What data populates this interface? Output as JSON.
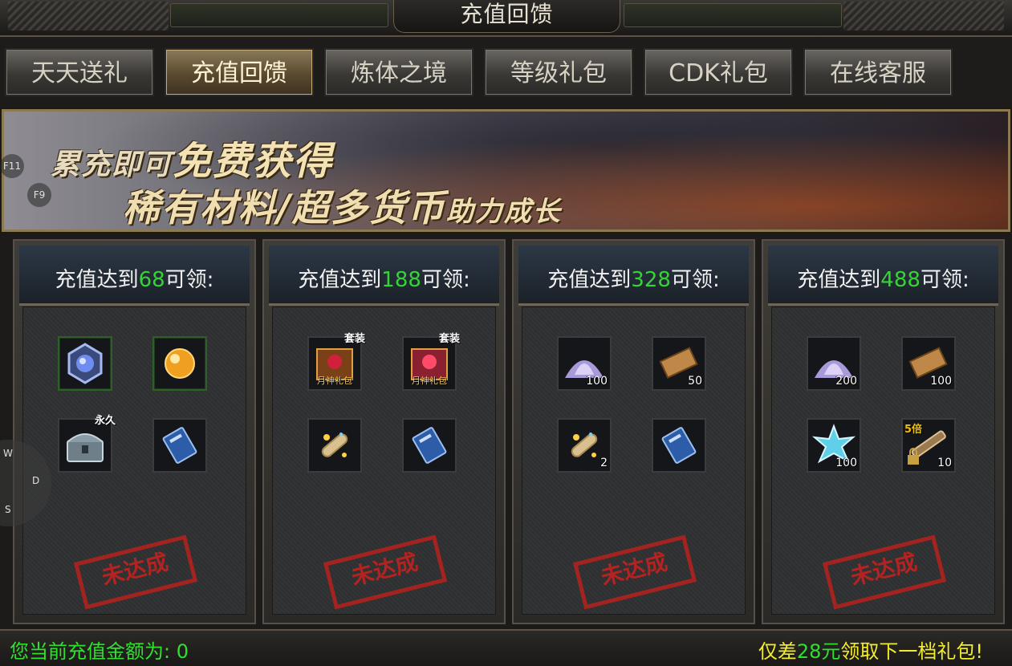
{
  "title": "充值回馈",
  "tabs": [
    {
      "label": "天天送礼",
      "active": false
    },
    {
      "label": "充值回馈",
      "active": true
    },
    {
      "label": "炼体之境",
      "active": false
    },
    {
      "label": "等级礼包",
      "active": false
    },
    {
      "label": "CDK礼包",
      "active": false
    },
    {
      "label": "在线客服",
      "active": false
    }
  ],
  "banner": {
    "line1_prefix": "累充即可",
    "line1_emph": "免费获得",
    "line2_main": "稀有材料/超多货币",
    "line2_suffix": "助力成长"
  },
  "hotkeys": {
    "f11": "F11",
    "f9": "F9"
  },
  "joystick": {
    "w": "W",
    "d": "D",
    "s": "S"
  },
  "panels": [
    {
      "head_prefix": "充值达到",
      "amount": "68",
      "head_suffix": "可领:",
      "status": "未达成",
      "items": [
        {
          "icon": "blue-orb-ring-icon",
          "count": "",
          "tag": ""
        },
        {
          "icon": "golden-pearl-icon",
          "count": "",
          "tag": ""
        },
        {
          "icon": "silver-chest-icon",
          "count": "",
          "tag": "永久"
        },
        {
          "icon": "blue-book-icon",
          "count": "",
          "tag": ""
        }
      ]
    },
    {
      "head_prefix": "充值达到",
      "amount": "188",
      "head_suffix": "可领:",
      "status": "未达成",
      "items": [
        {
          "icon": "moon-god-gift-box-icon",
          "count": "",
          "tag": "套装",
          "sub": "月神礼包"
        },
        {
          "icon": "moon-god-gift-box-red-icon",
          "count": "",
          "tag": "套装",
          "sub": "月神礼包"
        },
        {
          "icon": "sparkling-scroll-icon",
          "count": "",
          "tag": ""
        },
        {
          "icon": "blue-book-icon",
          "count": "",
          "tag": ""
        }
      ]
    },
    {
      "head_prefix": "充值达到",
      "amount": "328",
      "head_suffix": "可领:",
      "status": "未达成",
      "items": [
        {
          "icon": "purple-powder-icon",
          "count": "100",
          "tag": ""
        },
        {
          "icon": "parchment-scroll-icon",
          "count": "50",
          "tag": ""
        },
        {
          "icon": "sparkling-scroll-icon",
          "count": "2",
          "tag": ""
        },
        {
          "icon": "blue-book-icon",
          "count": "",
          "tag": ""
        }
      ]
    },
    {
      "head_prefix": "充值达到",
      "amount": "488",
      "head_suffix": "可领:",
      "status": "未达成",
      "items": [
        {
          "icon": "purple-powder-icon",
          "count": "200",
          "tag": ""
        },
        {
          "icon": "parchment-scroll-icon",
          "count": "100",
          "tag": ""
        },
        {
          "icon": "cyan-crystal-icon",
          "count": "100",
          "tag": ""
        },
        {
          "icon": "locked-telescope-icon",
          "count": "10",
          "tagl": "5倍"
        }
      ]
    }
  ],
  "footer": {
    "left": "您当前充值金额为: 0",
    "right_prefix": "仅差",
    "right_amount": "28元",
    "right_suffix": "领取下一档礼包!"
  },
  "colors": {
    "accent_green": "#35d435",
    "footer_yellow": "#f3ec2e",
    "stamp_red": "#c2221f"
  }
}
